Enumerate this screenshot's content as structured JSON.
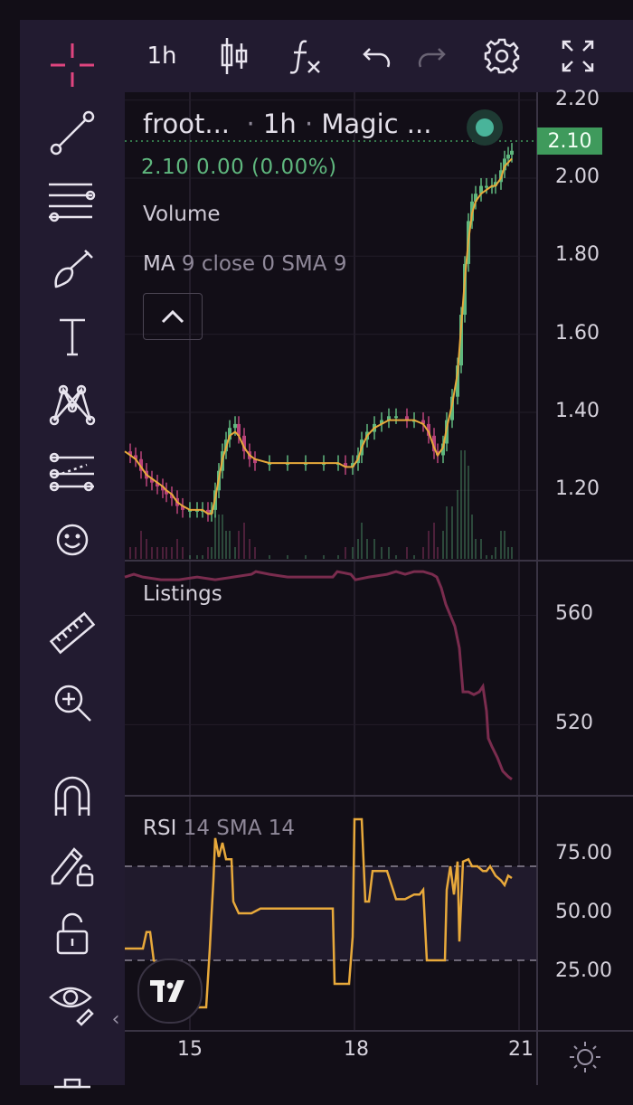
{
  "toolbar": {
    "tools": [
      "crosshair-icon",
      "trend-line-icon",
      "fib-retracement-icon",
      "brush-icon",
      "text-icon",
      "pattern-icon",
      "prediction-icon",
      "emoji-icon",
      "ruler-icon",
      "zoom-in-icon",
      "magnet-icon",
      "lock-drawing-icon",
      "unlock-icon",
      "eye-icon",
      "trash-icon"
    ],
    "collapse_label": "‹"
  },
  "topbar": {
    "interval": "1h",
    "buttons": [
      "candles-icon",
      "indicators-icon",
      "undo-icon",
      "redo-icon",
      "settings-icon",
      "fullscreen-icon"
    ]
  },
  "legend": {
    "symbol": "froot...",
    "interval": "1h",
    "exchange": "Magic ...",
    "change": "2.10  0.00 (0.00%)",
    "volume_label": "Volume",
    "ma_label": "MA",
    "ma_params": "9 close 0 SMA 9",
    "collapse_label": "^"
  },
  "price_badge": "2.10",
  "colors": {
    "up": "#5fb77e",
    "down": "#b9437a",
    "ma": "#e8a93b",
    "listings": "#7a2c4e",
    "rsi": "#e8a93b",
    "background": "#120e17",
    "panel": "#221b30"
  },
  "chart_data": [
    {
      "type": "candlestick",
      "title": "froot... · 1h · Magic ...",
      "ylim": [
        1.02,
        2.22
      ],
      "yticks": [
        "2.20",
        "2.00",
        "1.80",
        "1.60",
        "1.40",
        "1.20"
      ],
      "price_series": [
        [
          0,
          1.3
        ],
        [
          6,
          1.29
        ],
        [
          12,
          1.28
        ],
        [
          18,
          1.25
        ],
        [
          24,
          1.23
        ],
        [
          30,
          1.22
        ],
        [
          36,
          1.21
        ],
        [
          42,
          1.2
        ],
        [
          46,
          1.19
        ],
        [
          52,
          1.18
        ],
        [
          58,
          1.16
        ],
        [
          64,
          1.15
        ],
        [
          72,
          1.15
        ],
        [
          80,
          1.15
        ],
        [
          86,
          1.15
        ],
        [
          92,
          1.14
        ],
        [
          96,
          1.15
        ],
        [
          100,
          1.2
        ],
        [
          104,
          1.25
        ],
        [
          108,
          1.3
        ],
        [
          112,
          1.33
        ],
        [
          116,
          1.36
        ],
        [
          122,
          1.37
        ],
        [
          126,
          1.34
        ],
        [
          132,
          1.3
        ],
        [
          138,
          1.28
        ],
        [
          144,
          1.27
        ],
        [
          160,
          1.27
        ],
        [
          180,
          1.27
        ],
        [
          200,
          1.27
        ],
        [
          220,
          1.27
        ],
        [
          236,
          1.27
        ],
        [
          244,
          1.26
        ],
        [
          252,
          1.27
        ],
        [
          258,
          1.29
        ],
        [
          262,
          1.33
        ],
        [
          268,
          1.35
        ],
        [
          276,
          1.37
        ],
        [
          284,
          1.38
        ],
        [
          292,
          1.39
        ],
        [
          300,
          1.39
        ],
        [
          312,
          1.38
        ],
        [
          320,
          1.38
        ],
        [
          330,
          1.37
        ],
        [
          336,
          1.34
        ],
        [
          342,
          1.3
        ],
        [
          346,
          1.29
        ],
        [
          352,
          1.32
        ],
        [
          356,
          1.38
        ],
        [
          362,
          1.44
        ],
        [
          368,
          1.52
        ],
        [
          372,
          1.65
        ],
        [
          376,
          1.78
        ],
        [
          380,
          1.89
        ],
        [
          384,
          1.94
        ],
        [
          388,
          1.96
        ],
        [
          394,
          1.98
        ],
        [
          400,
          1.98
        ],
        [
          406,
          1.98
        ],
        [
          410,
          1.99
        ],
        [
          416,
          2.02
        ],
        [
          420,
          2.05
        ],
        [
          424,
          2.06
        ],
        [
          428,
          2.07
        ]
      ],
      "ma_series": [
        [
          0,
          1.3
        ],
        [
          6,
          1.29
        ],
        [
          12,
          1.28
        ],
        [
          18,
          1.26
        ],
        [
          24,
          1.24
        ],
        [
          30,
          1.23
        ],
        [
          36,
          1.22
        ],
        [
          42,
          1.21
        ],
        [
          46,
          1.2
        ],
        [
          52,
          1.19
        ],
        [
          58,
          1.17
        ],
        [
          64,
          1.16
        ],
        [
          72,
          1.15
        ],
        [
          80,
          1.15
        ],
        [
          86,
          1.15
        ],
        [
          92,
          1.14
        ],
        [
          96,
          1.14
        ],
        [
          100,
          1.18
        ],
        [
          104,
          1.23
        ],
        [
          108,
          1.28
        ],
        [
          112,
          1.31
        ],
        [
          116,
          1.34
        ],
        [
          122,
          1.35
        ],
        [
          126,
          1.34
        ],
        [
          132,
          1.31
        ],
        [
          138,
          1.29
        ],
        [
          144,
          1.28
        ],
        [
          160,
          1.27
        ],
        [
          180,
          1.27
        ],
        [
          200,
          1.27
        ],
        [
          220,
          1.27
        ],
        [
          236,
          1.27
        ],
        [
          244,
          1.26
        ],
        [
          252,
          1.26
        ],
        [
          258,
          1.28
        ],
        [
          262,
          1.31
        ],
        [
          268,
          1.34
        ],
        [
          276,
          1.36
        ],
        [
          284,
          1.37
        ],
        [
          292,
          1.38
        ],
        [
          300,
          1.38
        ],
        [
          312,
          1.38
        ],
        [
          320,
          1.38
        ],
        [
          330,
          1.37
        ],
        [
          336,
          1.35
        ],
        [
          342,
          1.31
        ],
        [
          346,
          1.29
        ],
        [
          352,
          1.31
        ],
        [
          356,
          1.36
        ],
        [
          362,
          1.42
        ],
        [
          368,
          1.5
        ],
        [
          372,
          1.62
        ],
        [
          376,
          1.74
        ],
        [
          380,
          1.84
        ],
        [
          384,
          1.91
        ],
        [
          388,
          1.94
        ],
        [
          394,
          1.96
        ],
        [
          400,
          1.97
        ],
        [
          406,
          1.98
        ],
        [
          410,
          1.98
        ],
        [
          416,
          2.0
        ],
        [
          420,
          2.03
        ],
        [
          424,
          2.04
        ],
        [
          428,
          2.05
        ]
      ],
      "current_price": 2.1
    },
    {
      "type": "line",
      "title": "Listings",
      "ylim": [
        494,
        580
      ],
      "yticks": [
        "560",
        "520"
      ],
      "series": [
        {
          "values": [
            [
              0,
              574
            ],
            [
              10,
              575
            ],
            [
              20,
              574
            ],
            [
              40,
              573
            ],
            [
              60,
              573
            ],
            [
              80,
              574
            ],
            [
              100,
              573
            ],
            [
              120,
              574
            ],
            [
              140,
              575
            ],
            [
              145,
              576
            ],
            [
              160,
              575
            ],
            [
              180,
              574
            ],
            [
              200,
              574
            ],
            [
              230,
              574
            ],
            [
              235,
              576
            ],
            [
              250,
              575
            ],
            [
              255,
              573
            ],
            [
              270,
              574
            ],
            [
              290,
              575
            ],
            [
              300,
              576
            ],
            [
              310,
              575
            ],
            [
              320,
              576
            ],
            [
              330,
              576
            ],
            [
              340,
              575
            ],
            [
              345,
              574
            ],
            [
              350,
              570
            ],
            [
              355,
              564
            ],
            [
              360,
              560
            ],
            [
              365,
              556
            ],
            [
              370,
              548
            ],
            [
              372,
              540
            ],
            [
              374,
              532
            ],
            [
              380,
              532
            ],
            [
              386,
              531
            ],
            [
              392,
              532
            ],
            [
              396,
              534
            ],
            [
              400,
              525
            ],
            [
              402,
              515
            ],
            [
              406,
              512
            ],
            [
              412,
              508
            ],
            [
              418,
              503
            ],
            [
              424,
              501
            ],
            [
              428,
              500
            ]
          ]
        }
      ]
    },
    {
      "type": "line",
      "title": "RSI",
      "title_params": "14 SMA 14",
      "ylim": [
        0,
        100
      ],
      "yticks": [
        "75.00",
        "50.00",
        "25.00"
      ],
      "bands": [
        30,
        70
      ],
      "series": [
        {
          "values": [
            [
              0,
              35
            ],
            [
              20,
              35
            ],
            [
              24,
              42
            ],
            [
              28,
              42
            ],
            [
              32,
              30
            ],
            [
              36,
              28
            ],
            [
              40,
              28
            ],
            [
              60,
              28
            ],
            [
              64,
              12
            ],
            [
              70,
              10
            ],
            [
              80,
              10
            ],
            [
              86,
              10
            ],
            [
              90,
              10
            ],
            [
              94,
              35
            ],
            [
              96,
              50
            ],
            [
              98,
              64
            ],
            [
              100,
              82
            ],
            [
              104,
              74
            ],
            [
              108,
              80
            ],
            [
              112,
              73
            ],
            [
              118,
              73
            ],
            [
              120,
              55
            ],
            [
              126,
              50
            ],
            [
              140,
              50
            ],
            [
              150,
              52
            ],
            [
              160,
              52
            ],
            [
              180,
              52
            ],
            [
              200,
              52
            ],
            [
              220,
              52
            ],
            [
              230,
              52
            ],
            [
              232,
              20
            ],
            [
              240,
              20
            ],
            [
              248,
              20
            ],
            [
              252,
              40
            ],
            [
              254,
              90
            ],
            [
              258,
              90
            ],
            [
              262,
              90
            ],
            [
              266,
              55
            ],
            [
              270,
              55
            ],
            [
              274,
              68
            ],
            [
              280,
              68
            ],
            [
              290,
              68
            ],
            [
              300,
              56
            ],
            [
              310,
              56
            ],
            [
              320,
              58
            ],
            [
              326,
              58
            ],
            [
              330,
              60
            ],
            [
              334,
              30
            ],
            [
              340,
              30
            ],
            [
              350,
              30
            ],
            [
              354,
              30
            ],
            [
              356,
              60
            ],
            [
              360,
              70
            ],
            [
              364,
              58
            ],
            [
              368,
              72
            ],
            [
              370,
              38
            ],
            [
              374,
              72
            ],
            [
              380,
              73
            ],
            [
              384,
              70
            ],
            [
              390,
              70
            ],
            [
              396,
              68
            ],
            [
              400,
              68
            ],
            [
              404,
              70
            ],
            [
              410,
              66
            ],
            [
              416,
              64
            ],
            [
              420,
              62
            ],
            [
              424,
              66
            ],
            [
              428,
              65
            ]
          ]
        }
      ]
    },
    {
      "type": "axis",
      "xticks": [
        "15",
        "18",
        "21"
      ]
    }
  ]
}
